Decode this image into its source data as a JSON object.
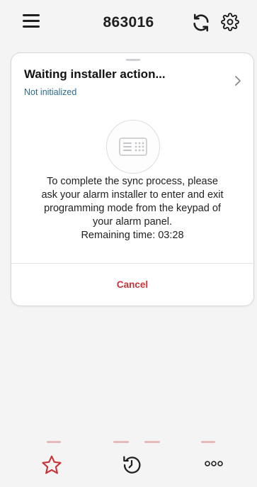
{
  "header": {
    "title": "863016",
    "menu_icon": "hamburger-menu-icon",
    "sync_icon": "sync-icon",
    "settings_icon": "gear-icon"
  },
  "card": {
    "title": "Waiting installer action...",
    "subtitle": "Not initialized",
    "illustration_icon": "keypad-icon",
    "message_lines": [
      "To complete the sync process, please",
      "ask your alarm installer to enter and exit",
      "programming mode from the keypad of",
      "your alarm panel.",
      "Remaining time: 03:28"
    ],
    "cancel_label": "Cancel"
  },
  "tabbar": {
    "items": [
      {
        "icon": "star-icon"
      },
      {
        "icon": "history-icon"
      },
      {
        "icon": "more-icon"
      }
    ]
  },
  "colors": {
    "accent": "#c8343a",
    "subtitle": "#2d6b8c",
    "background": "#f4f4f5",
    "card": "#ffffff"
  }
}
